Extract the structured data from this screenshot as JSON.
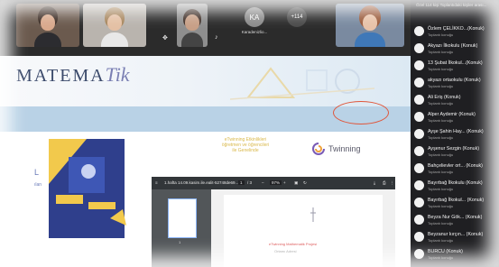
{
  "video_tiles": [
    {
      "label": ""
    },
    {
      "label": ""
    },
    {
      "label": ""
    },
    {
      "initials": "KA",
      "name": "Karadenizlio...",
      "accent": "#8a8a8a"
    },
    {
      "initials": "+114",
      "name": "",
      "accent": "#4a4a4a"
    },
    {
      "label": ""
    }
  ],
  "site": {
    "logo_main": "MATEMA",
    "logo_tik": "Tik",
    "nav_items": [
      "",
      "",
      "",
      "",
      "",
      "",
      "",
      ""
    ],
    "announcement": "eTwinning Etkinlikleri\nöğretmen ve öğrencileri\nile Genelinde",
    "twinning_label": "Twinning",
    "pdf": {
      "filename": "1.hafta 14.09.kasim.ile.ealit-52748de69...",
      "page": "1",
      "total": "/ 3",
      "zoom": "97%",
      "thumb_number": "1",
      "page_text": "eTwinning Mathematik Projesi",
      "page_meta": "Ortamı Adresi"
    }
  },
  "participants_panel": {
    "header": "Özel 114 kişi   Toplantıdaki kişiler arası...",
    "items": [
      {
        "name": "Özlem ÇELİKKO...(Konuk)",
        "role": "Toplantı konuğu"
      },
      {
        "name": "Akyazı İlkokulu (Konuk)",
        "role": "Toplantı konuğu"
      },
      {
        "name": "13 Şubat İlkokul...(Konuk)",
        "role": "Toplantı konuğu"
      },
      {
        "name": "akyazı ortaokulu (Konuk)",
        "role": "Toplantı konuğu"
      },
      {
        "name": "Ali Eriş (Konuk)",
        "role": "Toplantı konuğu"
      },
      {
        "name": "Alper Aydemir (Konuk)",
        "role": "Toplantı konuğu"
      },
      {
        "name": "Ayşe Şahin Hay... (Konuk)",
        "role": "Toplantı konuğu"
      },
      {
        "name": "Ayşenur Sezgin (Konuk)",
        "role": "Toplantı konuğu"
      },
      {
        "name": "Bahçelievler ort... (Konuk)",
        "role": "Toplantı konuğu"
      },
      {
        "name": "Bayırbağ İlkokulu (Konuk)",
        "role": "Toplantı konuğu"
      },
      {
        "name": "Bayırbağ İlkokul... (Konuk)",
        "role": "Toplantı konuğu"
      },
      {
        "name": "Beyza Nur Gök... (Konuk)",
        "role": "Toplantı konuğu"
      },
      {
        "name": "Beyzanur kırçın... (Konuk)",
        "role": "Toplantı konuğu"
      },
      {
        "name": "BURCU (Konuk)",
        "role": "Toplantı konuğu"
      }
    ]
  }
}
